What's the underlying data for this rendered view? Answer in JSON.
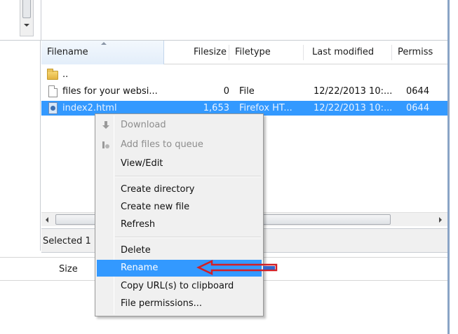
{
  "header": {
    "columns": [
      {
        "label": "Filename"
      },
      {
        "label": "Filesize"
      },
      {
        "label": "Filetype"
      },
      {
        "label": "Last modified"
      },
      {
        "label": "Permiss"
      }
    ]
  },
  "files": [
    {
      "name": "..",
      "size": "",
      "type": "",
      "modified": "",
      "perms": "",
      "icon": "folder-icon"
    },
    {
      "name": "files for your websi...",
      "size": "0",
      "type": "File",
      "modified": "12/22/2013 10:...",
      "perms": "0644",
      "icon": "file-icon"
    },
    {
      "name": "index2.html",
      "size": "1,653",
      "type": "Firefox HT...",
      "modified": "12/22/2013 10:...",
      "perms": "0644",
      "icon": "html-file-icon",
      "selected": true
    }
  ],
  "status": {
    "text": "Selected 1"
  },
  "bottom": {
    "size_label": "Size"
  },
  "context_menu": {
    "items": [
      {
        "label": "Download",
        "disabled": true,
        "icon": "download-icon"
      },
      {
        "label": "Add files to queue",
        "disabled": true,
        "icon": "add-to-queue-icon"
      },
      {
        "label": "View/Edit"
      },
      {
        "label": "Create directory"
      },
      {
        "label": "Create new file"
      },
      {
        "label": "Refresh"
      },
      {
        "label": "Delete"
      },
      {
        "label": "Rename",
        "highlighted": true
      },
      {
        "label": "Copy URL(s) to clipboard"
      },
      {
        "label": "File permissions..."
      }
    ]
  },
  "colors": {
    "selection": "#3399ff",
    "annotation_arrow": "#d21f26",
    "menu_bg": "#f0f0f0"
  }
}
